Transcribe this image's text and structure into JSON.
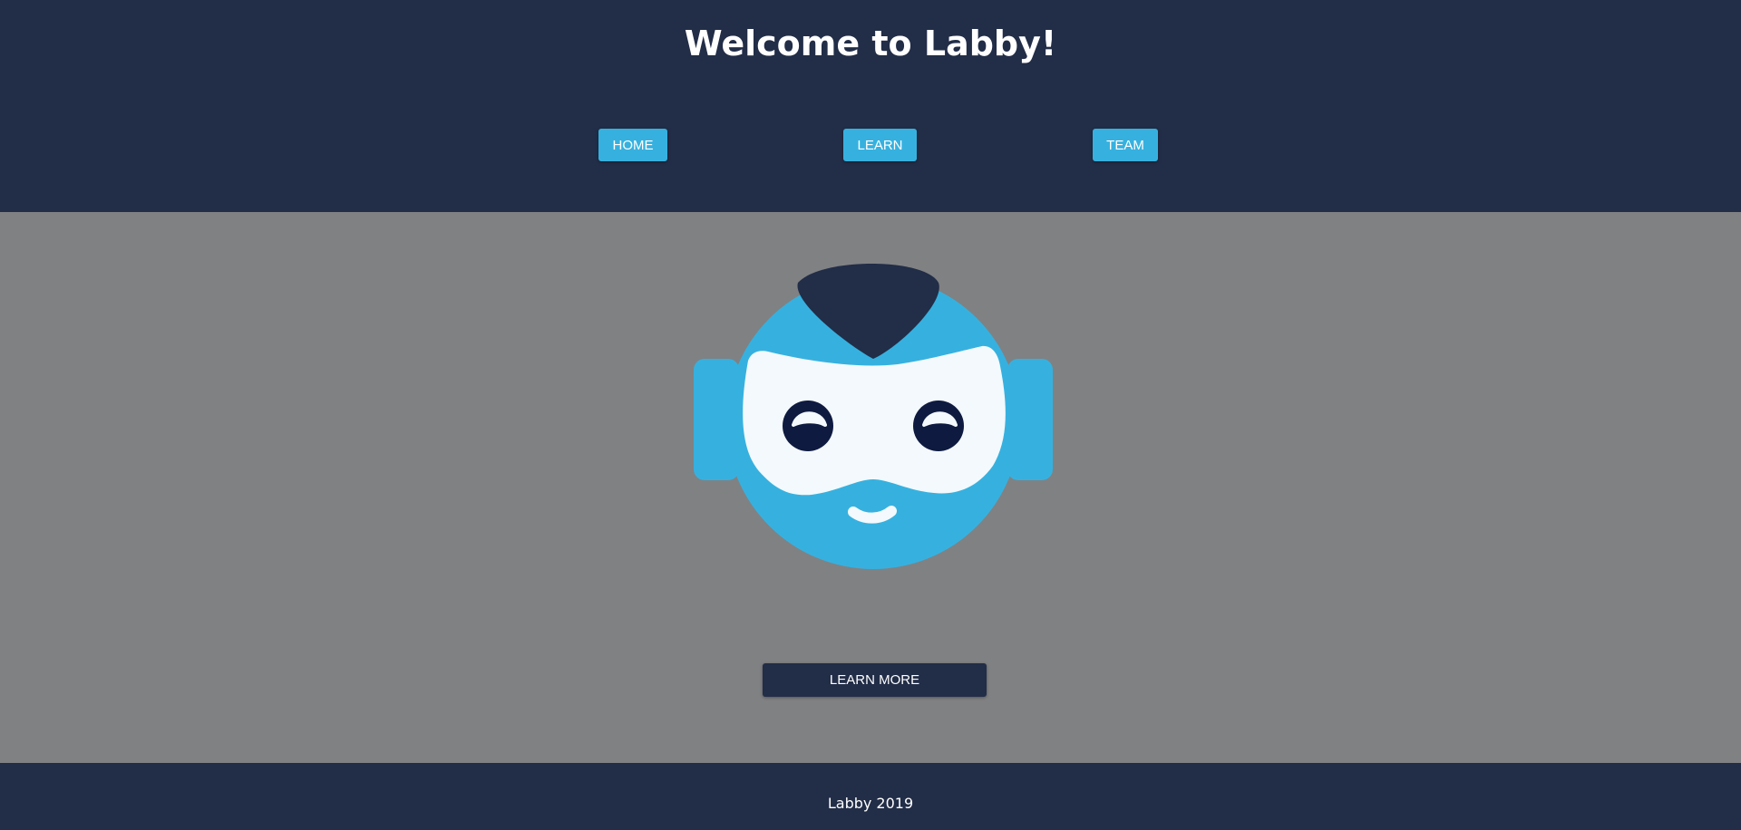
{
  "header": {
    "title": "Welcome to Labby!",
    "nav": [
      {
        "label": "HOME"
      },
      {
        "label": "LEARN"
      },
      {
        "label": "TEAM"
      }
    ]
  },
  "main": {
    "mascot_icon": "robot-mascot-icon",
    "cta_label": "LEARN MORE"
  },
  "footer": {
    "text": "Labby 2019"
  },
  "colors": {
    "navy": "#222d47",
    "accent_blue": "#36b1df",
    "background_gray": "#808183",
    "eye_dark": "#0e1a40",
    "face_white": "#f3f9fc"
  }
}
